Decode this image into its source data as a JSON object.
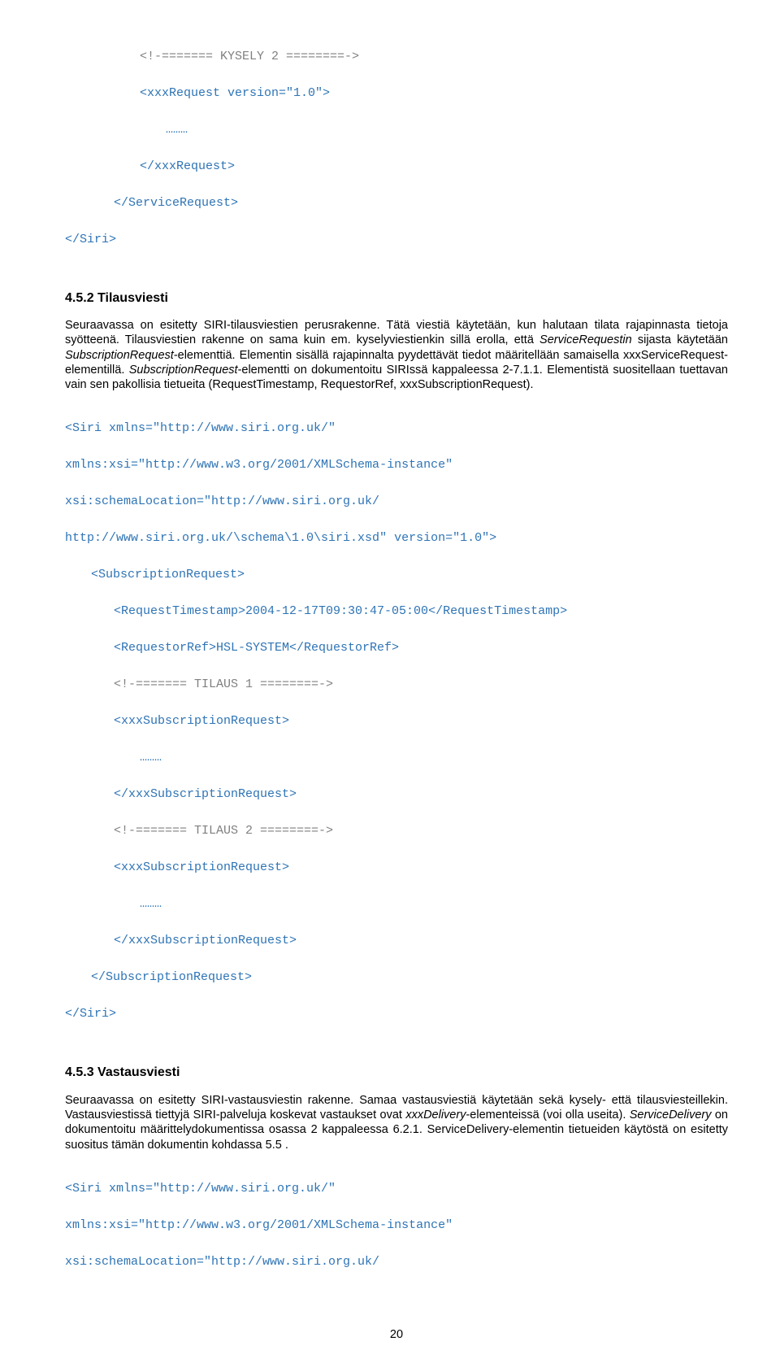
{
  "codeBlock1": {
    "l1": "<!-======= KYSELY 2 ========->",
    "l2": "<xxxRequest version=\"1.0\">",
    "l3": "………",
    "l4": "</xxxRequest>",
    "l5": "</ServiceRequest>",
    "l6": "</Siri>"
  },
  "heading452": "4.5.2  Tilausviesti",
  "para452": {
    "p1a": "Seuraavassa on esitetty SIRI-tilausviestien perusrakenne. Tätä viestiä käytetään, kun halutaan tilata rajapinnasta tietoja syötteenä. Tilausviestien rakenne on sama kuin em. kyselyviestienkin sillä erolla, että ",
    "p1b": "ServiceRequestin",
    "p1c": " sijasta käytetään ",
    "p1d": "SubscriptionRequest",
    "p1e": "-elementtiä. Elementin sisällä rajapinnalta pyydettävät tiedot määritellään samaisella xxxServiceRequest-elementillä. ",
    "p1f": "SubscriptionRequest",
    "p1g": "-elementti on dokumentoitu SIRIssä kappaleessa 2-7.1.1. Elementistä suositellaan tuettavan vain sen pakollisia tietueita (RequestTimestamp, RequestorRef, xxxSubscriptionRequest)."
  },
  "codeBlock2": {
    "l1": "<Siri xmlns=\"http://www.siri.org.uk/\"",
    "l2": "xmlns:xsi=\"http://www.w3.org/2001/XMLSchema-instance\"",
    "l3": "xsi:schemaLocation=\"http://www.siri.org.uk/",
    "l4": "http://www.siri.org.uk/\\schema\\1.0\\siri.xsd\" version=\"1.0\">",
    "l5": "<SubscriptionRequest>",
    "l6": "<RequestTimestamp>2004-12-17T09:30:47-05:00</RequestTimestamp>",
    "l7": "<RequestorRef>HSL-SYSTEM</RequestorRef>",
    "l8": "<!-======= TILAUS 1 ========->",
    "l9": "<xxxSubscriptionRequest>",
    "l10": "………",
    "l11": "</xxxSubscriptionRequest>",
    "l12": "<!-======= TILAUS 2 ========->",
    "l13": "<xxxSubscriptionRequest>",
    "l14": "………",
    "l15": "</xxxSubscriptionRequest>",
    "l16": "</SubscriptionRequest>",
    "l17": "</Siri>"
  },
  "heading453": "4.5.3  Vastausviesti",
  "para453": {
    "p1a": "Seuraavassa on esitetty SIRI-vastausviestin rakenne. Samaa vastausviestiä käytetään sekä kysely- että tilausviesteillekin. Vastausviestissä tiettyjä SIRI-palveluja koskevat vastaukset ovat ",
    "p1b": "xxxDelivery",
    "p1c": "-elementeissä (voi olla useita). ",
    "p1d": "ServiceDelivery",
    "p1e": " on dokumentoitu määrittelydokumentissa osassa 2 kappaleessa 6.2.1. ServiceDelivery-elementin tietueiden käytöstä on esitetty suositus tämän dokumentin kohdassa 5.5 ."
  },
  "codeBlock3": {
    "l1": "<Siri xmlns=\"http://www.siri.org.uk/\"",
    "l2": "xmlns:xsi=\"http://www.w3.org/2001/XMLSchema-instance\"",
    "l3": "xsi:schemaLocation=\"http://www.siri.org.uk/"
  },
  "pageNumber": "20"
}
